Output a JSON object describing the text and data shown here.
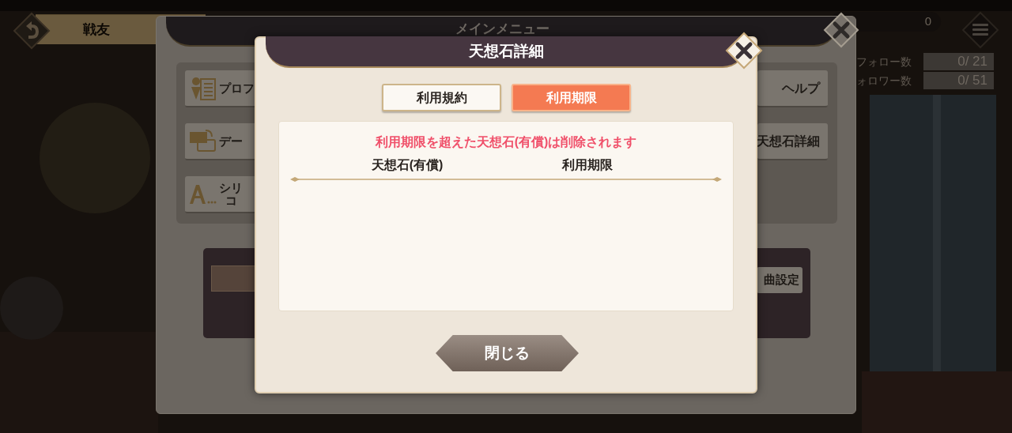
{
  "background_screen": {
    "title": "戦友",
    "currency_count": "0",
    "stats": [
      {
        "label": "フォロー数",
        "value": "0/ 21"
      },
      {
        "label": "ォロワー数",
        "value": "0/ 51"
      }
    ]
  },
  "main_menu": {
    "title": "メインメニュー",
    "left_buttons": [
      {
        "kind": "profile",
        "lines": [
          "プロフ"
        ]
      },
      {
        "kind": "data",
        "lines": [
          "デー"
        ]
      },
      {
        "kind": "font",
        "lines": [
          "シリ",
          "コ"
        ]
      }
    ],
    "right_buttons": [
      "ヘルプ",
      "天想石詳細"
    ],
    "bottom_button": "曲設定"
  },
  "dialog": {
    "title": "天想石詳細",
    "tabs": [
      {
        "label": "利用規約",
        "selected": false
      },
      {
        "label": "利用期限",
        "selected": true
      }
    ],
    "notice": "利用期限を超えた天想石(有償)は削除されます",
    "columns": [
      "天想石(有償)",
      "利用期限"
    ],
    "close_button": "閉じる"
  }
}
